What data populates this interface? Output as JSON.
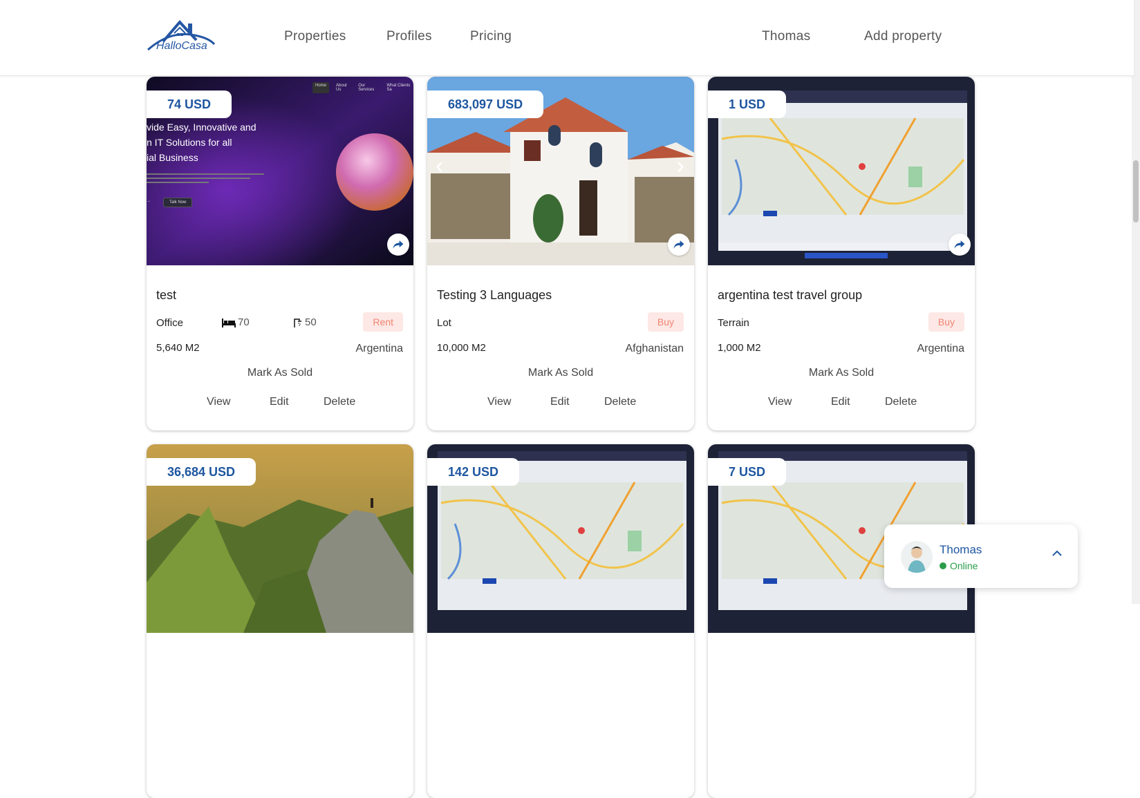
{
  "header": {
    "logo_text": "HalloCasa",
    "nav": [
      "Properties",
      "Profiles",
      "Pricing"
    ],
    "user": "Thomas",
    "add_property": "Add property"
  },
  "cards": [
    {
      "price": "74 USD",
      "title": "test",
      "type": "Office",
      "beds": "70",
      "baths": "50",
      "badge": "Rent",
      "area": "5,640 M2",
      "country": "Argentina",
      "sold": "Mark As Sold",
      "view": "View",
      "edit": "Edit",
      "delete": "Delete",
      "image": {
        "headline": [
          "vide Easy, Innovative and",
          "n IT Solutions for all",
          "ial Business"
        ],
        "nav": [
          "Home",
          "About Us",
          "Our Services",
          "What Clients Sa"
        ],
        "cta": "Talk Now"
      }
    },
    {
      "price": "683,097 USD",
      "title": "Testing 3 Languages",
      "type": "Lot",
      "badge": "Buy",
      "area": "10,000 M2",
      "country": "Afghanistan",
      "sold": "Mark As Sold",
      "view": "View",
      "edit": "Edit",
      "delete": "Delete"
    },
    {
      "price": "1 USD",
      "title": "argentina test travel group",
      "type": "Terrain",
      "badge": "Buy",
      "area": "1,000 M2",
      "country": "Argentina",
      "sold": "Mark As Sold",
      "view": "View",
      "edit": "Edit",
      "delete": "Delete"
    },
    {
      "price": "36,684 USD"
    },
    {
      "price": "142 USD"
    },
    {
      "price": "7 USD"
    }
  ],
  "chat": {
    "name": "Thomas",
    "status": "Online"
  },
  "colors": {
    "brand": "#1e56a0",
    "badge_bg": "#fde8e6",
    "badge_text": "#f08470",
    "online": "#2a9d4a"
  }
}
